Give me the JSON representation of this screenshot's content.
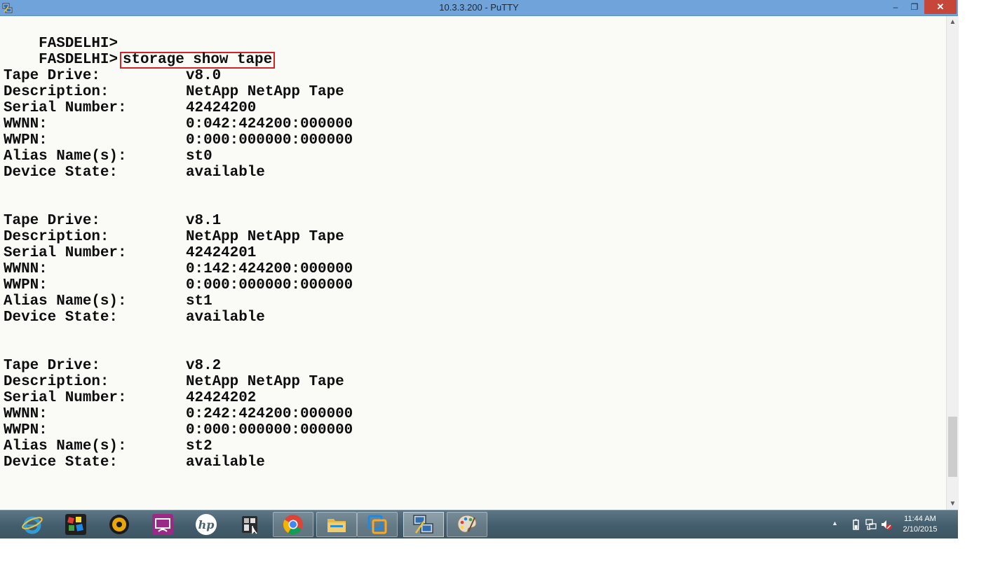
{
  "window": {
    "title": "10.3.3.200 - PuTTY",
    "buttons": {
      "minimize": "‒",
      "maximize": "❐",
      "close": "✕"
    }
  },
  "terminal": {
    "prompts": [
      "FASDELHI>",
      "FASDELHI>"
    ],
    "command": "storage show tape",
    "drives": [
      {
        "rows": [
          {
            "label": "Tape Drive:",
            "value": "v8.0"
          },
          {
            "label": "Description:",
            "value": "NetApp NetApp Tape"
          },
          {
            "label": "Serial Number:",
            "value": "42424200"
          },
          {
            "label": "WWNN:",
            "value": "0:042:424200:000000"
          },
          {
            "label": "WWPN:",
            "value": "0:000:000000:000000"
          },
          {
            "label": "Alias Name(s):",
            "value": "st0"
          },
          {
            "label": "Device State:",
            "value": "available"
          }
        ]
      },
      {
        "rows": [
          {
            "label": "Tape Drive:",
            "value": "v8.1"
          },
          {
            "label": "Description:",
            "value": "NetApp NetApp Tape"
          },
          {
            "label": "Serial Number:",
            "value": "42424201"
          },
          {
            "label": "WWNN:",
            "value": "0:142:424200:000000"
          },
          {
            "label": "WWPN:",
            "value": "0:000:000000:000000"
          },
          {
            "label": "Alias Name(s):",
            "value": "st1"
          },
          {
            "label": "Device State:",
            "value": "available"
          }
        ]
      },
      {
        "rows": [
          {
            "label": "Tape Drive:",
            "value": "v8.2"
          },
          {
            "label": "Description:",
            "value": "NetApp NetApp Tape"
          },
          {
            "label": "Serial Number:",
            "value": "42424202"
          },
          {
            "label": "WWNN:",
            "value": "0:242:424200:000000"
          },
          {
            "label": "WWPN:",
            "value": "0:000:000000:000000"
          },
          {
            "label": "Alias Name(s):",
            "value": "st2"
          },
          {
            "label": "Device State:",
            "value": "available"
          }
        ]
      }
    ],
    "highlight_color": "#d2232a"
  },
  "taskbar": {
    "apps": [
      {
        "name": "internet-explorer-icon"
      },
      {
        "name": "colorful-cubes-app-icon"
      },
      {
        "name": "media-player-icon"
      },
      {
        "name": "remote-display-icon"
      },
      {
        "name": "hp-icon"
      },
      {
        "name": "utility-app-icon"
      },
      {
        "name": "chrome-icon"
      },
      {
        "name": "file-explorer-icon"
      },
      {
        "name": "vmware-icon"
      },
      {
        "name": "putty-icon"
      },
      {
        "name": "paint-icon"
      }
    ],
    "clock": {
      "time": "11:44 AM",
      "date": "2/10/2015"
    }
  },
  "colors": {
    "titlebar": "#6fa3d9",
    "close_button": "#c7463a",
    "terminal_bg": "#fafaf7",
    "taskbar": "#435d6c"
  }
}
